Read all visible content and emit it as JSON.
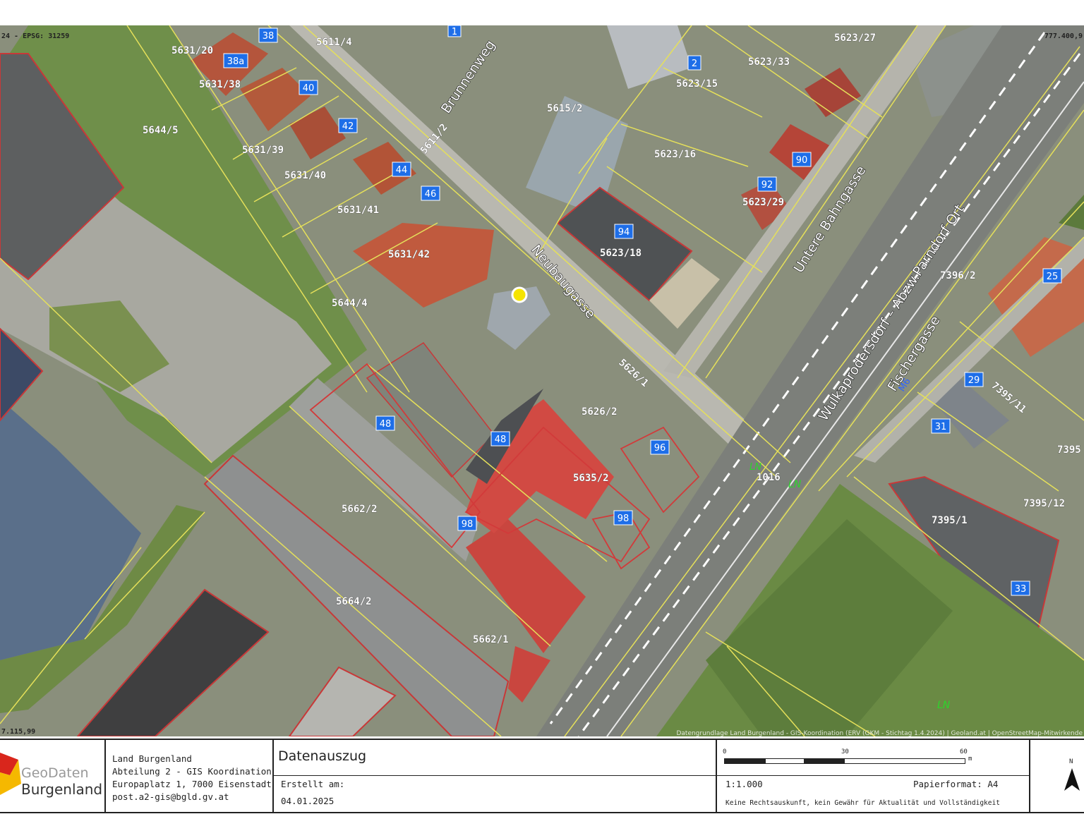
{
  "map": {
    "coord_top_left": "24 - EPSG: 31259",
    "coord_top_right": "777.400,9",
    "coord_bottom_left": "7.115,99",
    "attribution": "Datengrundlage Land Burgenland - GIS-Koordination (ERV (GKM - Stichtag 1.4.2024) | Geoland.at | OpenStreetMap-Mitwirkende",
    "streets": [
      {
        "name": "Brunnenweg"
      },
      {
        "name": "Neubaugasse"
      },
      {
        "name": "Untere Bahngasse"
      },
      {
        "name": "Wulkaprodersdorf – Abzw.Parndorf Ort"
      },
      {
        "name": "Fischergasse"
      }
    ],
    "parcels": [
      "5611/4",
      "5631/20",
      "5631/38",
      "5644/5",
      "5631/39",
      "5631/40",
      "5631/41",
      "5631/42",
      "5644/4",
      "5611/2",
      "5615/2",
      "5623/27",
      "5623/33",
      "5623/15",
      "5623/16",
      "5623/29",
      "5623/18",
      "7396/2",
      "5626/1",
      "5626/2",
      "5635/2",
      "5662/2",
      "5664/2",
      "5662/1",
      "1016",
      "7395/11",
      "7395",
      "7395/12",
      "7395/1"
    ],
    "house_numbers": [
      "38",
      "38a",
      "40",
      "42",
      "44",
      "46",
      "1",
      "2",
      "90",
      "92",
      "94",
      "48",
      "48",
      "96",
      "98",
      "98",
      "25",
      "29",
      "31",
      "33"
    ],
    "zone_labels": [
      "LN",
      "LN",
      "LN",
      "M6"
    ]
  },
  "footer": {
    "logo": {
      "brand_line1": "GeoDaten",
      "brand_line2": "Burgenland"
    },
    "org": [
      "Land Burgenland",
      "Abteilung 2 - GIS Koordination",
      "Europaplatz 1, 7000 Eisenstadt",
      "post.a2-gis@bgld.gv.at"
    ],
    "title": "Datenauszug",
    "created_label": "Erstellt am:",
    "created_date": "04.01.2025",
    "scale_ticks": [
      "0",
      "30",
      "60"
    ],
    "scale_unit": "m",
    "scale": "1:1.000",
    "paper_format": "Papierformat: A4",
    "disclaimer": "Keine Rechtsauskunft, kein Gewähr für Aktualität und Vollständigkeit",
    "north": "N"
  }
}
